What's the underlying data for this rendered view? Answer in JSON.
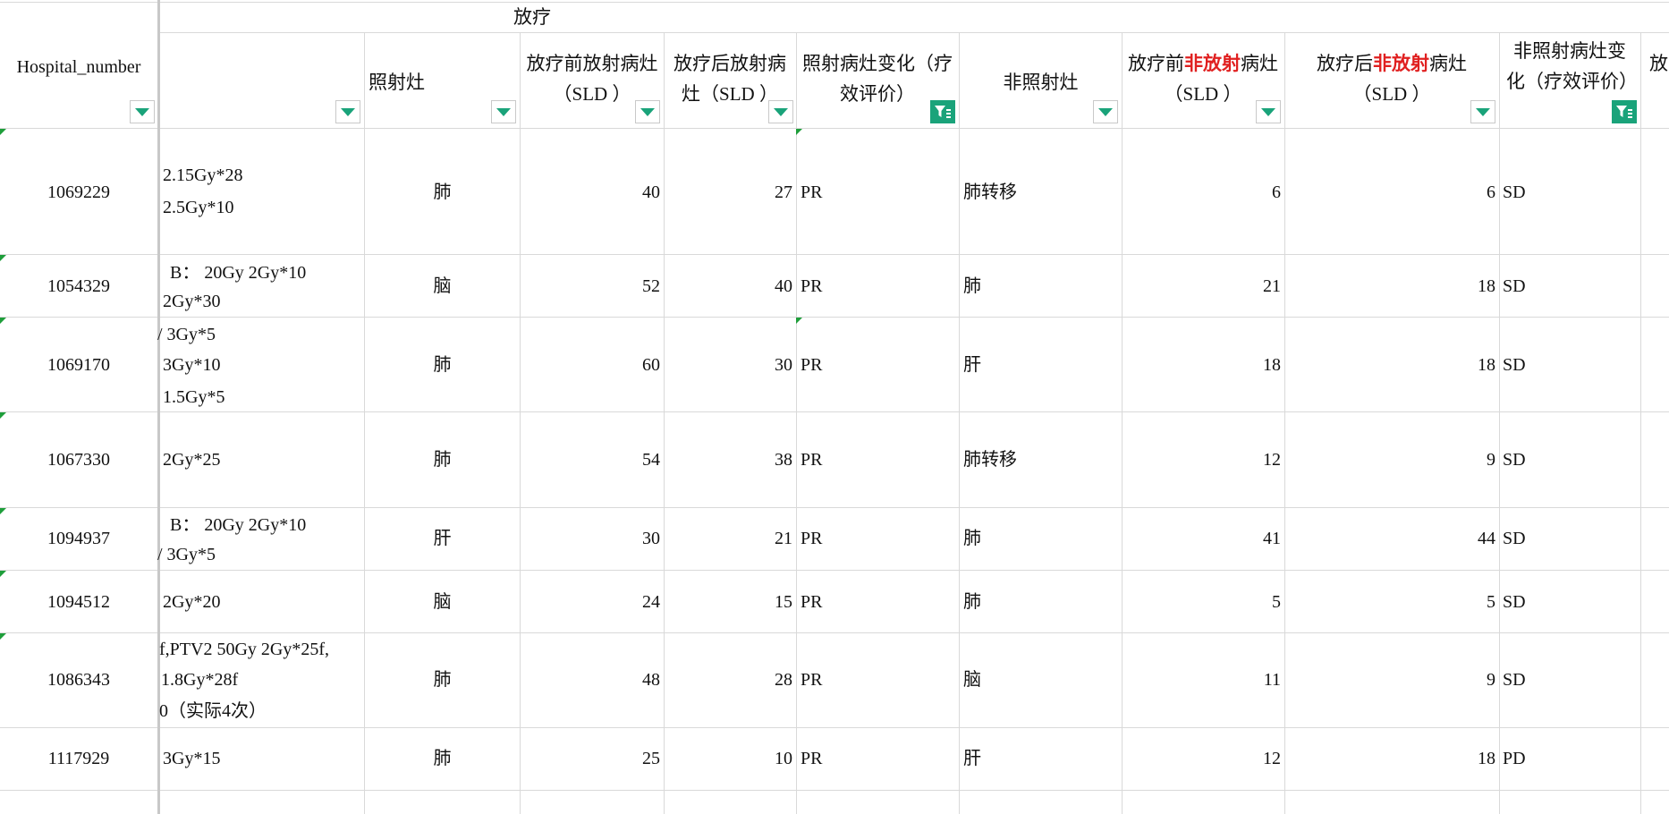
{
  "header": {
    "group_title": "放疗",
    "hospital_number": "Hospital_number",
    "col_site": "照射灶",
    "col_pre_rad": "放疗前放射病灶（SLD ）",
    "col_post_rad": "放疗后放射病灶（SLD ）",
    "col_rad_change": "照射病灶变化（疗效评价）",
    "col_nonrad_site": "非照射灶",
    "col_pre_nonrad_a": "放疗前",
    "col_pre_nonrad_red": "非放射",
    "col_pre_nonrad_b": "病灶（SLD ）",
    "col_post_nonrad_a": "放疗后",
    "col_post_nonrad_red": "非放射",
    "col_post_nonrad_b": "病灶（SLD ）",
    "col_nonrad_change": "非照射病灶变化（疗效评价）",
    "col_next_partial": "放"
  },
  "rows": [
    {
      "id": "1069229",
      "dose": [
        "2.15Gy*28",
        "2.5Gy*10"
      ],
      "site": "肺",
      "pre": "40",
      "post": "27",
      "eval": "PR",
      "nsite": "肺转移",
      "npre": "6",
      "npost": "6",
      "neval": "SD"
    },
    {
      "id": "1054329",
      "dose": [
        "B： 20Gy 2Gy*10",
        "2Gy*30"
      ],
      "site": "脑",
      "pre": "52",
      "post": "40",
      "eval": "PR",
      "nsite": "肺",
      "npre": "21",
      "npost": "18",
      "neval": "SD"
    },
    {
      "id": "1069170",
      "dose": [
        "/ 3Gy*5",
        "3Gy*10",
        "1.5Gy*5"
      ],
      "site": "肺",
      "pre": "60",
      "post": "30",
      "eval": "PR",
      "nsite": "肝",
      "npre": "18",
      "npost": "18",
      "neval": "SD"
    },
    {
      "id": "1067330",
      "dose": [
        "2Gy*25"
      ],
      "site": "肺",
      "pre": "54",
      "post": "38",
      "eval": "PR",
      "nsite": "肺转移",
      "npre": "12",
      "npost": "9",
      "neval": "SD"
    },
    {
      "id": "1094937",
      "dose": [
        "B： 20Gy 2Gy*10",
        "/ 3Gy*5"
      ],
      "site": "肝",
      "pre": "30",
      "post": "21",
      "eval": "PR",
      "nsite": "肺",
      "npre": "41",
      "npost": "44",
      "neval": "SD"
    },
    {
      "id": "1094512",
      "dose": [
        "2Gy*20"
      ],
      "site": "脑",
      "pre": "24",
      "post": "15",
      "eval": "PR",
      "nsite": "肺",
      "npre": "5",
      "npost": "5",
      "neval": "SD"
    },
    {
      "id": "1086343",
      "dose": [
        "f,PTV2 50Gy 2Gy*25f,",
        "1.8Gy*28f",
        "0（实际4次）"
      ],
      "site": "肺",
      "pre": "48",
      "post": "28",
      "eval": "PR",
      "nsite": "脑",
      "npre": "11",
      "npost": "9",
      "neval": "SD"
    },
    {
      "id": "1117929",
      "dose": [
        "3Gy*15"
      ],
      "site": "肺",
      "pre": "25",
      "post": "10",
      "eval": "PR",
      "nsite": "肝",
      "npre": "12",
      "npost": "18",
      "neval": "PD"
    }
  ],
  "colors": {
    "grid": "#d9d9d9",
    "accent": "#1aa37a",
    "red_text": "#e02020",
    "comment_tick": "#1e9e3a"
  }
}
